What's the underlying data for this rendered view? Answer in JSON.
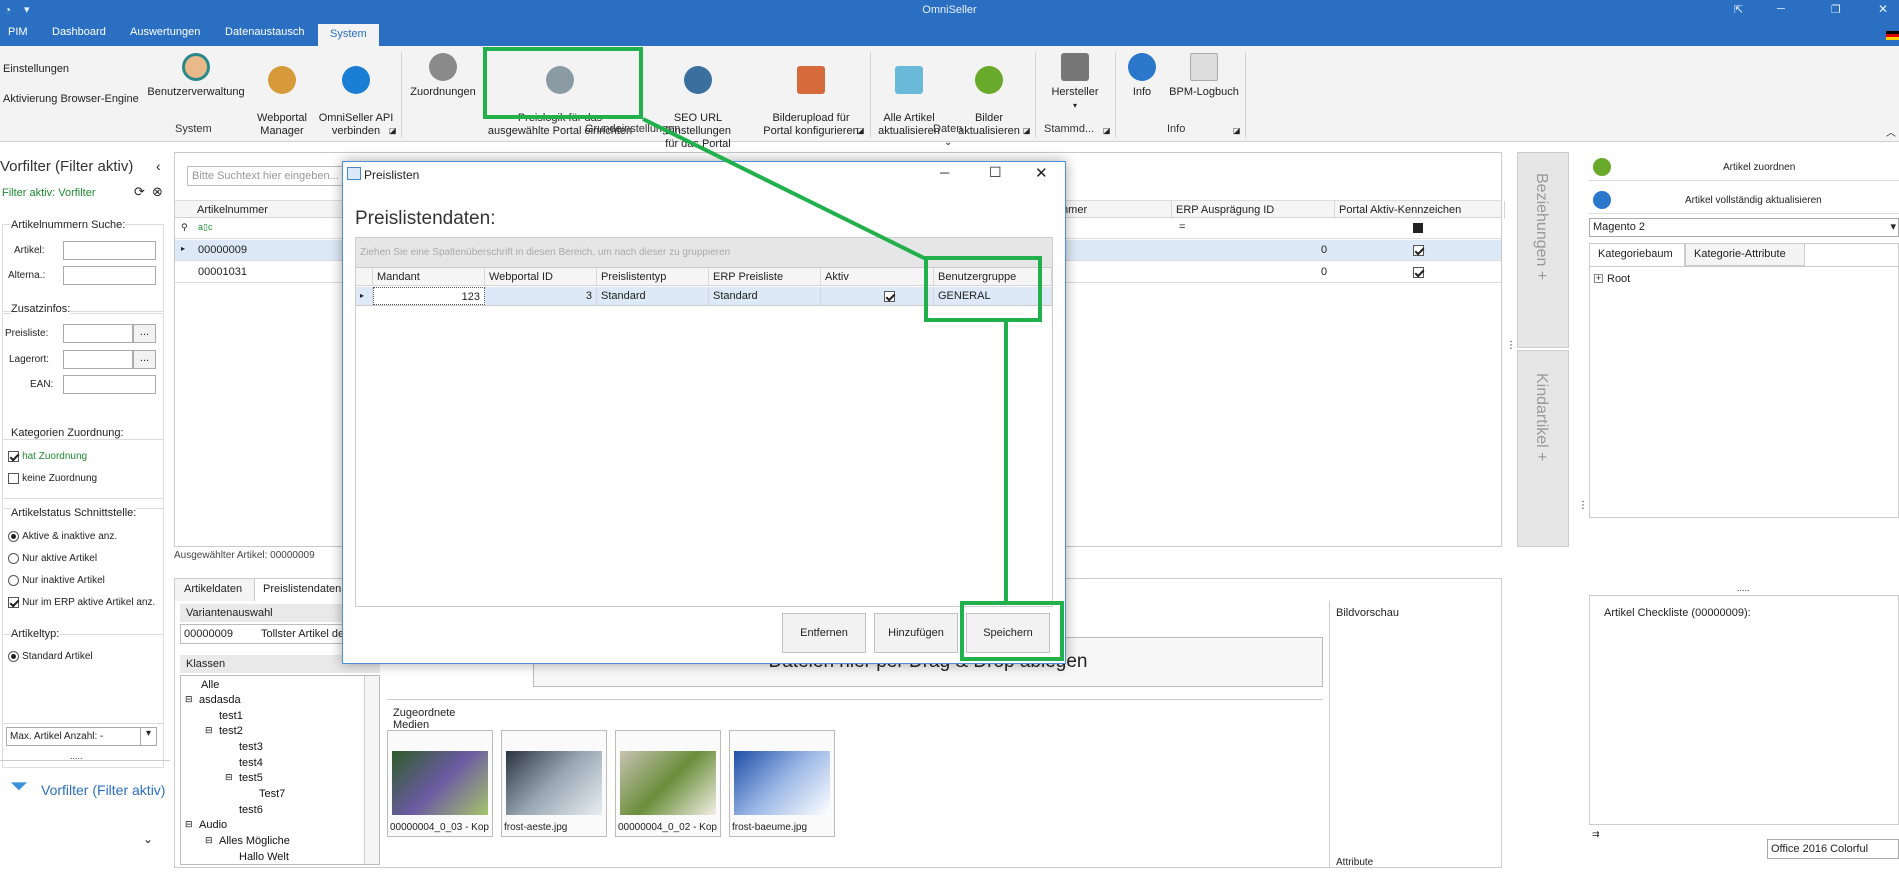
{
  "app": {
    "title": "OmniSeller"
  },
  "ribbon_tabs": [
    "PIM",
    "Dashboard",
    "Auswertungen",
    "Datenaustausch",
    "System"
  ],
  "ribbon": {
    "settings_label": "Einstellungen",
    "browser_engine_label": "Aktivierung Browser-Engine",
    "user_admin": "Benutzerverwaltung",
    "webportal_manager": "Webportal\nManager",
    "omniseller_api": "OmniSeller API\nverbinden",
    "zuordnungen": "Zuordnungen",
    "preislogik": "Preislogik für das\nausgewählte Portal einrichten",
    "seo_url": "SEO URL Einstellungen\nfür das Portal",
    "bilderupload": "Bilderupload für\nPortal konfigurieren",
    "alle_artikel": "Alle Artikel\naktualisieren",
    "bilder": "Bilder\naktualisieren",
    "hersteller": "Hersteller",
    "info": "Info",
    "bpm_logbuch": "BPM-Logbuch",
    "groups": {
      "system": "System",
      "grundeinstellungen": "Grundeinstellungen",
      "daten": "Daten",
      "stammd": "Stammd...",
      "info": "Info"
    }
  },
  "left_panel": {
    "title": "Vorfilter (Filter aktiv)",
    "filter_active": "Filter aktiv: Vorfilter",
    "artnr_search": "Artikelnummern Suche:",
    "artikel_label": "Artikel:",
    "alterna_label": "Alterna.:",
    "zusatzinfos": "Zusatzinfos:",
    "preisliste_label": "Preisliste:",
    "lagerort_label": "Lagerort:",
    "ean_label": "EAN:",
    "ellipsis": "...",
    "kategorien": "Kategorien Zuordnung:",
    "hat_zuordnung": "hat Zuordnung",
    "keine_zuordnung": "keine Zuordnung",
    "artikelstatus": "Artikelstatus Schnittstelle:",
    "aktive_inaktive": "Aktive & inaktive anz.",
    "nur_aktive": "Nur aktive Artikel",
    "nur_inaktive": "Nur inaktive Artikel",
    "nur_erp": "Nur im ERP aktive Artikel anz.",
    "artikeltyp": "Artikeltyp:",
    "standard_artikel": "Standard Artikel",
    "max_anzahl": "Max. Artikel Anzahl: -",
    "dots": ".....",
    "bottom_title": "Vorfilter (Filter aktiv)"
  },
  "main_grid": {
    "search_placeholder": "Bitte Suchtext hier eingeben...",
    "col_artikelnummer": "Artikelnummer",
    "col_mmer": "mmer",
    "col_erp": "ERP Ausprägung ID",
    "col_portal": "Portal Aktiv-Kennzeichen",
    "filter_icon_text": "a▯c",
    "eq_sign": "=",
    "rows": [
      {
        "nr": "00000009",
        "erp": "0"
      },
      {
        "nr": "00001031",
        "erp": "0"
      }
    ],
    "selected": "Ausgewählter Artikel: 00000009"
  },
  "side_tabs": {
    "beziehungen": "Beziehungen +",
    "kindartikel": "Kindartikel +"
  },
  "right_panel": {
    "zuordnen": "Artikel zuordnen",
    "aktualisieren": "Artikel vollständig aktualisieren",
    "magento": "Magento 2",
    "tab_kategoriebaum": "Kategoriebaum",
    "tab_kategorie_attribute": "Kategorie-Attribute",
    "root": "Root",
    "dots": ".....",
    "checkliste": "Artikel Checkliste (00000009):",
    "theme": "Office 2016 Colorful",
    "small_mark": "⇉"
  },
  "bottom": {
    "tab_artikeldaten": "Artikeldaten",
    "tab_preislisten": "Preislistendaten",
    "variantenauswahl": "Variantenauswahl",
    "variant_nr": "00000009",
    "variant_name": "Tollster Artikel der",
    "klassen": "Klassen",
    "tree": [
      "Alle",
      "asdasda",
      "test1",
      "test2",
      "test3",
      "test4",
      "test5",
      "Test7",
      "test6",
      "Audio",
      "Alles Mögliche",
      "Hallo Welt"
    ],
    "drop_text": "Dateien hier per Drag & Drop ablegen",
    "zugeordnete_medien": "Zugeordnete Medien",
    "bildvorschau": "Bildvorschau",
    "attribute": "Attribute",
    "media": [
      {
        "name": "00000004_0_03 - Kop",
        "colors": [
          "#2f5d2a",
          "#6b5aa3",
          "#a5c46a"
        ]
      },
      {
        "name": "frost-aeste.jpg",
        "colors": [
          "#2a3440",
          "#9aa8b4",
          "#e8eef2"
        ]
      },
      {
        "name": "00000004_0_02 - Kop",
        "colors": [
          "#c7c2b2",
          "#6a8e3a",
          "#f2efe6"
        ]
      },
      {
        "name": "frost-baeume.jpg",
        "colors": [
          "#1e4ea8",
          "#9cb8e6",
          "#ffffff"
        ]
      }
    ]
  },
  "dialog": {
    "title": "Preislisten",
    "heading": "Preislistendaten:",
    "group_hint": "Ziehen Sie eine Spaltenüberschrift in diesen Bereich, um nach dieser zu gruppieren",
    "columns": [
      "Mandant",
      "Webportal ID",
      "Preislistentyp",
      "ERP Preisliste",
      "Aktiv",
      "Benutzergruppe"
    ],
    "row": {
      "mandant": "123",
      "webportal": "3",
      "typ": "Standard",
      "erp": "Standard",
      "gruppe": "GENERAL"
    },
    "btn_entfernen": "Entfernen",
    "btn_hinzufuegen": "Hinzufügen",
    "btn_speichern": "Speichern"
  },
  "colors": {
    "accent": "#2b6fc2",
    "highlight": "#21b04b",
    "filter_green": "#1e8c32",
    "link_blue": "#2b6fc2"
  }
}
